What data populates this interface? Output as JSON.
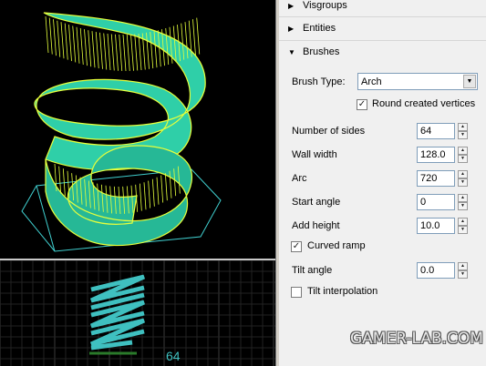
{
  "viewport_3d": {
    "description_colors": {
      "fill": "#2fcfa8",
      "wire": "#e6ff3c"
    }
  },
  "viewport_2d": {
    "label": "64",
    "label_color": "#3fc0c0"
  },
  "panel": {
    "sections": [
      {
        "label": "Visgroups",
        "expanded": false
      },
      {
        "label": "Entities",
        "expanded": false
      },
      {
        "label": "Brushes",
        "expanded": true
      }
    ],
    "brush_type": {
      "label": "Brush Type:",
      "value": "Arch"
    },
    "round_vertices": {
      "label": "Round created vertices",
      "checked": true
    },
    "fields": [
      {
        "label": "Number of sides",
        "value": "64"
      },
      {
        "label": "Wall width",
        "value": "128.0"
      },
      {
        "label": "Arc",
        "value": "720"
      },
      {
        "label": "Start angle",
        "value": "0"
      },
      {
        "label": "Add height",
        "value": "10.0"
      }
    ],
    "curved_ramp": {
      "label": "Curved ramp",
      "checked": true
    },
    "tilt_angle": {
      "label": "Tilt angle",
      "value": "0.0"
    },
    "tilt_interpolation": {
      "label": "Tilt interpolation",
      "checked": false
    }
  },
  "watermark": {
    "text": "GAMER-LAB.COM"
  }
}
